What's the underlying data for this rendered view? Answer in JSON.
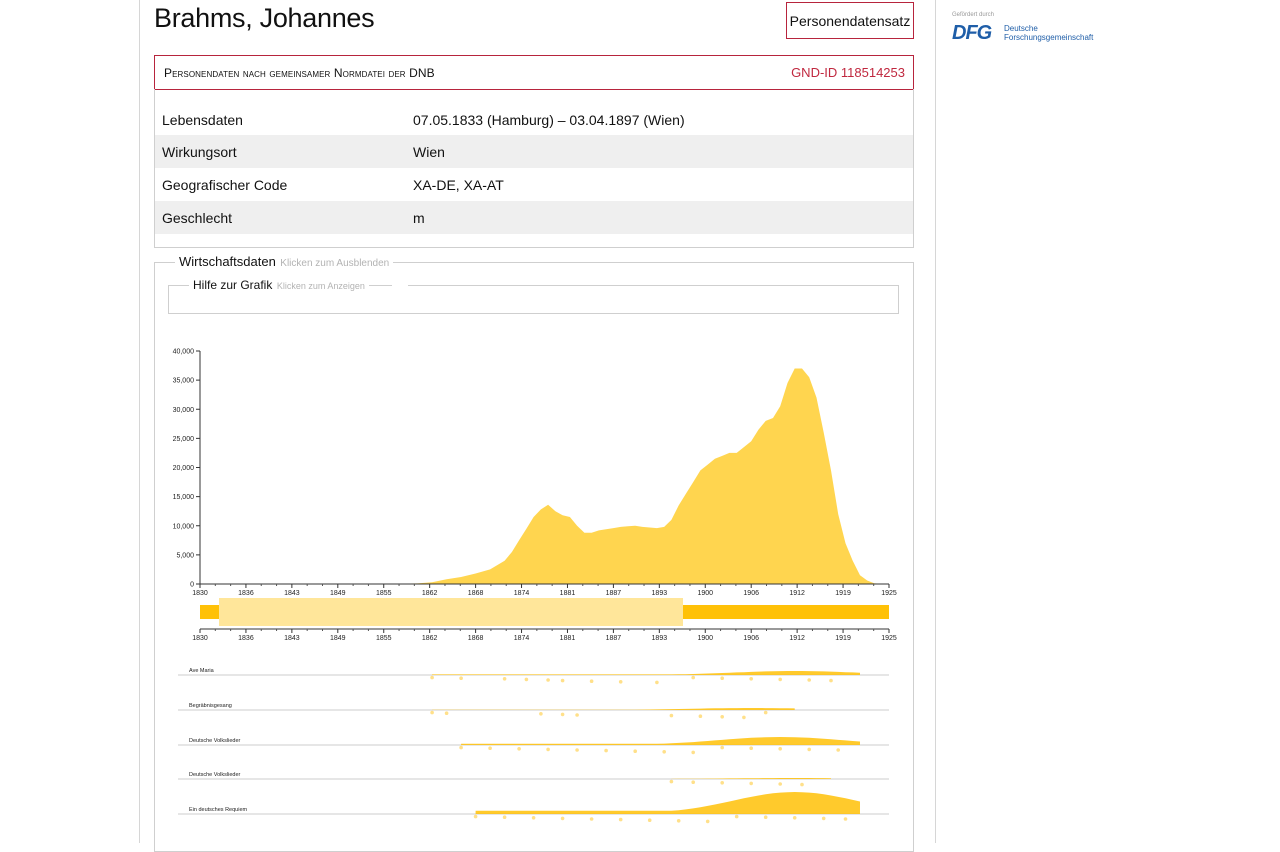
{
  "person": {
    "name": "Brahms, Johannes",
    "record_button": "Personendatensatz"
  },
  "gnd": {
    "header": "Personendaten nach gemeinsamer Normdatei der DNB",
    "id_label": "GND-ID 118514253",
    "rows": [
      {
        "label": "Lebensdaten",
        "value": "07.05.1833 (Hamburg) – 03.04.1897 (Wien)"
      },
      {
        "label": "Wirkungsort",
        "value": "Wien"
      },
      {
        "label": "Geografischer Code",
        "value": "XA-DE, XA-AT"
      },
      {
        "label": "Geschlecht",
        "value": "m"
      }
    ]
  },
  "wirtschaftsdaten": {
    "title": "Wirtschaftsdaten",
    "toggle": "Klicken zum Ausblenden"
  },
  "hilfe": {
    "title": "Hilfe zur Grafik",
    "toggle": "Klicken zum Anzeigen"
  },
  "sponsor": {
    "small_text": "Gefördert durch",
    "mark": "DFG",
    "line1": "Deutsche",
    "line2": "Forschungsgemeinschaft"
  },
  "colors": {
    "area": "#ffd54f",
    "brush_bar": "#ffc107",
    "brush_window": "#ffe69a",
    "dots": "#ffe08a",
    "accent": "#b7243d"
  },
  "chart_data": [
    {
      "type": "area",
      "title": "",
      "xlabel": "",
      "ylabel": "",
      "xlim": [
        1830,
        1925
      ],
      "ylim": [
        0,
        40000
      ],
      "yticks": [
        "0",
        "5,000",
        "10,000",
        "15,000",
        "20,000",
        "25,000",
        "30,000",
        "35,000",
        "40,000"
      ],
      "xticks": [
        "1830",
        "1836",
        "1843",
        "1849",
        "1855",
        "1862",
        "1868",
        "1874",
        "1881",
        "1887",
        "1893",
        "1900",
        "1906",
        "1912",
        "1919",
        "1925"
      ],
      "series": [
        {
          "x": [
            1830,
            1855,
            1860,
            1862,
            1864,
            1866,
            1868,
            1870,
            1872,
            1873,
            1874,
            1875,
            1876,
            1877,
            1878,
            1879,
            1880,
            1881,
            1882,
            1883,
            1884,
            1885,
            1886,
            1887,
            1888,
            1889,
            1890,
            1891,
            1892,
            1893,
            1894,
            1895,
            1896,
            1897,
            1898,
            1899,
            1900,
            1901,
            1902,
            1903,
            1904,
            1905,
            1906,
            1907,
            1908,
            1909,
            1910,
            1911,
            1912,
            1913,
            1914,
            1915,
            1916,
            1917,
            1918,
            1919,
            1920,
            1921,
            1922,
            1923,
            1925
          ],
          "values": [
            0,
            0,
            100,
            300,
            800,
            1200,
            1800,
            2500,
            4000,
            5500,
            7500,
            9500,
            11500,
            12800,
            13600,
            12500,
            11800,
            11500,
            10000,
            8800,
            8800,
            9200,
            9400,
            9600,
            9800,
            9900,
            10000,
            9800,
            9700,
            9600,
            9800,
            11000,
            13500,
            15500,
            17500,
            19500,
            20500,
            21500,
            22000,
            22500,
            22500,
            23500,
            24500,
            26500,
            28000,
            28500,
            30500,
            34500,
            37000,
            37000,
            35500,
            32000,
            26000,
            19500,
            12000,
            7000,
            4000,
            1500,
            600,
            100,
            0
          ]
        }
      ]
    },
    {
      "type": "scatter",
      "title": "",
      "xlim": [
        1830,
        1925
      ],
      "series": [
        {
          "name": "Ave Maria",
          "x": [
            1862,
            1866,
            1872,
            1875,
            1878,
            1880,
            1884,
            1888,
            1893,
            1898,
            1902,
            1906,
            1910,
            1914,
            1917
          ],
          "values": [
            1,
            1,
            1,
            1,
            1,
            1,
            1,
            1,
            1,
            1,
            1,
            1,
            1,
            1,
            1
          ]
        },
        {
          "name": "Begräbnisgesang",
          "x": [
            1862,
            1864,
            1877,
            1880,
            1882,
            1895,
            1899,
            1902,
            1905,
            1908
          ],
          "values": [
            1,
            1,
            1,
            1,
            1,
            1,
            1,
            1,
            1,
            1
          ]
        },
        {
          "name": "Deutsche Volkslieder",
          "x": [
            1866,
            1870,
            1874,
            1878,
            1882,
            1886,
            1890,
            1894,
            1898,
            1902,
            1906,
            1910,
            1914,
            1918
          ],
          "values": [
            1,
            1,
            1,
            1,
            1,
            1,
            1,
            1,
            1,
            1,
            1,
            1,
            1,
            1
          ]
        },
        {
          "name": "Deutsche Volkslieder",
          "x": [
            1895,
            1898,
            1902,
            1906,
            1910,
            1913
          ],
          "values": [
            1,
            1,
            1,
            1,
            1,
            1
          ]
        },
        {
          "name": "Ein deutsches Requiem",
          "x": [
            1868,
            1872,
            1876,
            1880,
            1884,
            1888,
            1892,
            1896,
            1900,
            1904,
            1908,
            1912,
            1916,
            1919
          ],
          "values": [
            1,
            1,
            1,
            1,
            1,
            1,
            1,
            1,
            1,
            1,
            1,
            1,
            1,
            1
          ]
        }
      ]
    }
  ]
}
